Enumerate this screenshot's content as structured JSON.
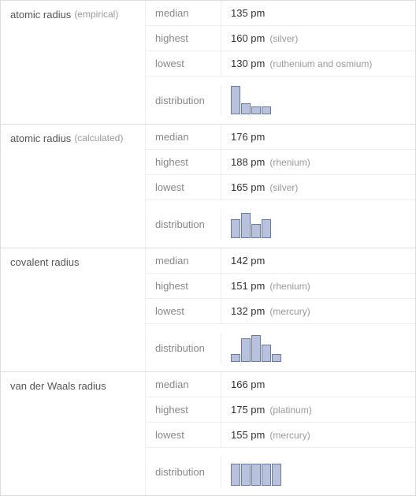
{
  "properties": [
    {
      "name": "atomic radius",
      "subnote": "(empirical)",
      "stats": {
        "median": {
          "value": "135 pm",
          "qual": ""
        },
        "highest": {
          "value": "160 pm",
          "qual": "(silver)"
        },
        "lowest": {
          "value": "130 pm",
          "qual": "(ruthenium and osmium)"
        }
      },
      "chart_data": {
        "type": "bar",
        "values": [
          36,
          14,
          10,
          10
        ],
        "title": "",
        "xlabel": "",
        "ylabel": ""
      }
    },
    {
      "name": "atomic radius",
      "subnote": "(calculated)",
      "stats": {
        "median": {
          "value": "176 pm",
          "qual": ""
        },
        "highest": {
          "value": "188 pm",
          "qual": "(rhenium)"
        },
        "lowest": {
          "value": "165 pm",
          "qual": "(silver)"
        }
      },
      "chart_data": {
        "type": "bar",
        "values": [
          24,
          32,
          18,
          24
        ],
        "title": "",
        "xlabel": "",
        "ylabel": ""
      }
    },
    {
      "name": "covalent radius",
      "subnote": "",
      "stats": {
        "median": {
          "value": "142 pm",
          "qual": ""
        },
        "highest": {
          "value": "151 pm",
          "qual": "(rhenium)"
        },
        "lowest": {
          "value": "132 pm",
          "qual": "(mercury)"
        }
      },
      "chart_data": {
        "type": "bar",
        "values": [
          10,
          30,
          34,
          22,
          10
        ],
        "title": "",
        "xlabel": "",
        "ylabel": ""
      }
    },
    {
      "name": "van der Waals radius",
      "subnote": "",
      "stats": {
        "median": {
          "value": "166 pm",
          "qual": ""
        },
        "highest": {
          "value": "175 pm",
          "qual": "(platinum)"
        },
        "lowest": {
          "value": "155 pm",
          "qual": "(mercury)"
        }
      },
      "chart_data": {
        "type": "bar",
        "values": [
          28,
          28,
          28,
          28,
          28
        ],
        "title": "",
        "xlabel": "",
        "ylabel": ""
      }
    }
  ],
  "labels": {
    "median": "median",
    "highest": "highest",
    "lowest": "lowest",
    "distribution": "distribution"
  }
}
